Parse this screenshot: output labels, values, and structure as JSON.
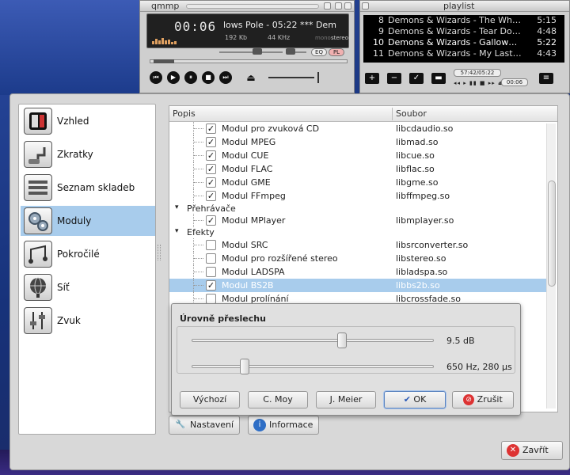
{
  "player": {
    "title": "qmmp",
    "time": "00:06",
    "song": "lows Pole - 05:22   *** Dem",
    "bitrate": "192 Kb",
    "frequency": "44 KHz",
    "mono": "mono",
    "stereo": "stereo",
    "eq_label": "EQ",
    "pl_label": "PL"
  },
  "playlist": {
    "title": "playlist",
    "rows": [
      {
        "num": "8",
        "title": "Demons & Wizards - The Wh…",
        "dur": "5:15"
      },
      {
        "num": "9",
        "title": "Demons & Wizards - Tear Do…",
        "dur": "4:48"
      },
      {
        "num": "10",
        "title": "Demons & Wizards - Gallow…",
        "dur": "5:22"
      },
      {
        "num": "11",
        "title": "Demons & Wizards - My Last…",
        "dur": "4:43"
      }
    ],
    "total_time": "57:42/05:22",
    "cur_time": "00:06"
  },
  "sidebar": {
    "items": [
      {
        "label": "Vzhled"
      },
      {
        "label": "Zkratky"
      },
      {
        "label": "Seznam skladeb"
      },
      {
        "label": "Moduly"
      },
      {
        "label": "Pokročilé"
      },
      {
        "label": "Síť"
      },
      {
        "label": "Zvuk"
      }
    ]
  },
  "table": {
    "col_desc": "Popis",
    "col_file": "Soubor",
    "rows_top": [
      {
        "name": "Modul pro zvuková CD",
        "file": "libcdaudio.so",
        "checked": true
      },
      {
        "name": "Modul MPEG",
        "file": "libmad.so",
        "checked": true
      },
      {
        "name": "Modul CUE",
        "file": "libcue.so",
        "checked": true
      },
      {
        "name": "Modul FLAC",
        "file": "libflac.so",
        "checked": true
      },
      {
        "name": "Modul GME",
        "file": "libgme.so",
        "checked": true
      },
      {
        "name": "Modul FFmpeg",
        "file": "libffmpeg.so",
        "checked": true
      }
    ],
    "group_players": "Přehrávače",
    "players": [
      {
        "name": "Modul MPlayer",
        "file": "libmplayer.so",
        "checked": true
      }
    ],
    "group_effects": "Efekty",
    "effects": [
      {
        "name": "Modul SRC",
        "file": "libsrconverter.so",
        "checked": false
      },
      {
        "name": "Modul pro rozšířené stereo",
        "file": "libstereo.so",
        "checked": false
      },
      {
        "name": "Modul LADSPA",
        "file": "libladspa.so",
        "checked": false
      },
      {
        "name": "Modul BS2B",
        "file": "libbs2b.so",
        "checked": true
      },
      {
        "name": "Modul prolínání",
        "file": "libcrossfade.so",
        "checked": false
      }
    ]
  },
  "popup": {
    "title": "Úrovně přeslechu",
    "slider1_value": "9.5 dB",
    "slider1_level": 0.62,
    "slider2_value": "650 Hz, 280 µs",
    "slider2_level": 0.22,
    "buttons": {
      "default": "Výchozí",
      "cmoy": "C. Moy",
      "jmeier": "J. Meier",
      "ok": "OK",
      "cancel": "Zrušit"
    }
  },
  "bottom": {
    "settings": "Nastavení",
    "info": "Informace",
    "close": "Zavřít"
  }
}
